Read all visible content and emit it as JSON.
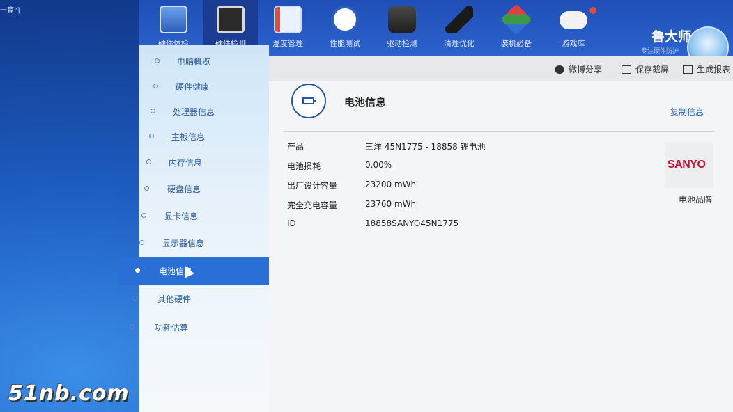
{
  "desktop": {
    "texts": [
      "一篇\"]"
    ],
    "watermark": "51nb.com"
  },
  "topbar": {
    "tabs": [
      {
        "label": "硬件体检",
        "icon": "monitor-icon",
        "active": false
      },
      {
        "label": "硬件检测",
        "icon": "monitor-chip-icon",
        "active": true
      },
      {
        "label": "温度管理",
        "icon": "thermometer-icon",
        "active": false
      },
      {
        "label": "性能测试",
        "icon": "gauge-icon",
        "active": false
      },
      {
        "label": "驱动检测",
        "icon": "chip-icon",
        "active": false
      },
      {
        "label": "清理优化",
        "icon": "broom-icon",
        "active": false
      },
      {
        "label": "装机必备",
        "icon": "cube-icon",
        "active": false
      },
      {
        "label": "游戏库",
        "icon": "gamepad-icon",
        "active": false
      }
    ],
    "brand": "鲁大师",
    "brand_sub": "专注硬件防护"
  },
  "sidebar": {
    "items": [
      {
        "label": "电脑概览"
      },
      {
        "label": "硬件健康"
      },
      {
        "label": "处理器信息"
      },
      {
        "label": "主板信息"
      },
      {
        "label": "内存信息"
      },
      {
        "label": "硬盘信息"
      },
      {
        "label": "显卡信息"
      },
      {
        "label": "显示器信息"
      },
      {
        "label": "电池信息",
        "active": true
      },
      {
        "label": "其他硬件"
      },
      {
        "label": "功耗估算"
      }
    ]
  },
  "toolbar": {
    "share": "微博分享",
    "save": "保存截屏",
    "report": "生成报表"
  },
  "main": {
    "title": "电池信息",
    "copy": "复制信息",
    "rows": [
      {
        "key": "产品",
        "value": "三洋 45N1775 - 18858 锂电池"
      },
      {
        "key": "电池损耗",
        "value": "0.00%"
      },
      {
        "key": "出厂设计容量",
        "value": "23200 mWh"
      },
      {
        "key": "完全充电容量",
        "value": "23760 mWh"
      },
      {
        "key": "ID",
        "value": "18858SANYO45N1775"
      }
    ],
    "brand_logo": "SANYO",
    "brand_label": "电池品牌"
  },
  "colors": {
    "topbar": "#2c62cc",
    "active_nav": "#2a6fd6",
    "logo_red": "#c8102e"
  }
}
